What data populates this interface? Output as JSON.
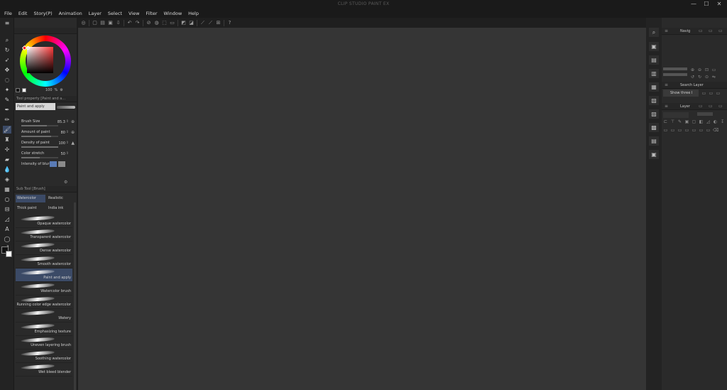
{
  "app": {
    "title": "CLIP STUDIO PAINT EX",
    "window_buttons": [
      "—",
      "☐",
      "✕"
    ]
  },
  "menu": [
    "File",
    "Edit",
    "Story(P)",
    "Animation",
    "Layer",
    "Select",
    "View",
    "Filter",
    "Window",
    "Help"
  ],
  "command_bar": {
    "icons": [
      "clip-studio-icon",
      "new-icon",
      "open-icon",
      "save-icon",
      "export-icon",
      "undo-icon",
      "redo-icon",
      "clear-icon",
      "fill-icon",
      "transform-icon",
      "deselect-icon",
      "invert-selection-icon",
      "show-selection-icon",
      "snap-ruler-icon",
      "snap-special-ruler-icon",
      "snap-grid-icon",
      "help-icon"
    ]
  },
  "color_panel": {
    "opacity_value": "100",
    "opacity_unit": "%"
  },
  "tool_property": {
    "title": "Tool property [Paint and a...",
    "preset_label": "Paint and apply",
    "properties": [
      {
        "label": "Brush Size",
        "value": "85.3",
        "fill": 0.7
      },
      {
        "label": "Amount of paint",
        "value": "80",
        "fill": 0.8
      },
      {
        "label": "Density of paint",
        "value": "100",
        "fill": 1.0
      },
      {
        "label": "Color stretch",
        "value": "50",
        "fill": 0.5
      },
      {
        "label": "Intensity of blur",
        "value": "",
        "fill": 0.0
      }
    ]
  },
  "sub_tool": {
    "title": "Sub Tool [Brush]",
    "tabs": [
      "Watercolor",
      "Realistic",
      "Thick paint",
      "India ink"
    ],
    "active_tab": "Watercolor",
    "brushes": [
      "Opaque watercolor",
      "Transparent watercolor",
      "Dense watercolor",
      "Smooth watercolor",
      "Paint and apply",
      "Watercolor brush",
      "Running color edge watercolor",
      "Watery",
      "Emphasizing texture",
      "Uneven layering brush",
      "Soothing watercolor",
      "Wet bleed blender"
    ],
    "active_brush": "Paint and apply"
  },
  "right_panels": {
    "navigator": {
      "title": "Navig"
    },
    "layer_search": {
      "title": "Search Layer",
      "dropdown": "Show three l"
    },
    "layer": {
      "title": "Layer"
    }
  },
  "colors": {
    "canvas_bg": "#353535",
    "panel_bg": "#2a2a2a",
    "accent": "#3b4a66"
  }
}
